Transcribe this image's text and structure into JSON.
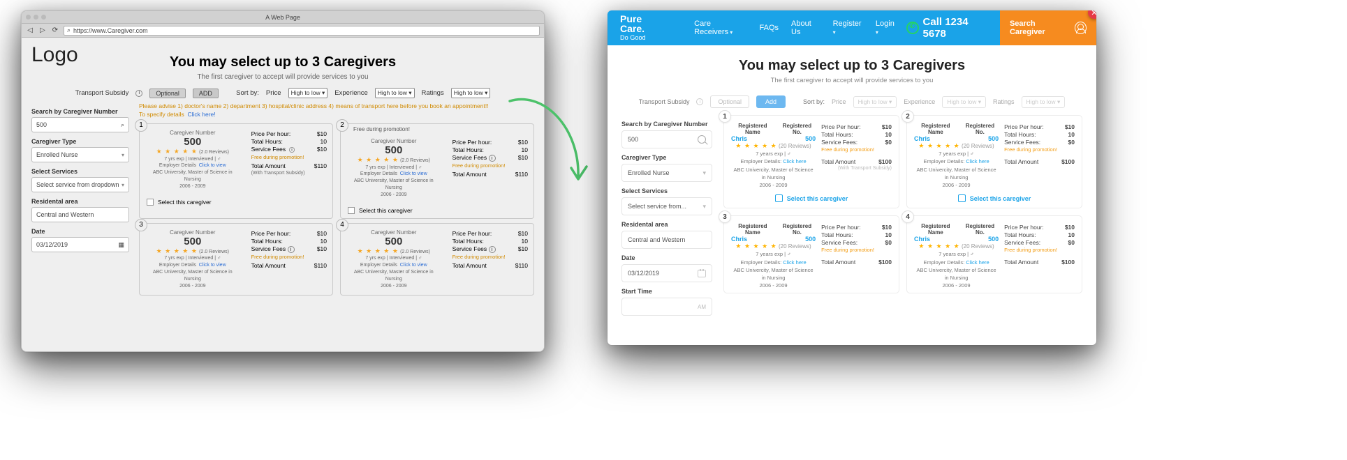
{
  "wire": {
    "window_title": "A Web Page",
    "url": "https://www.Caregiver.com",
    "logo": "Logo",
    "h1": "You may select up to 3 Caregivers",
    "sub": "The first caregiver to accept will provide services to you",
    "filter": {
      "subsidy_label": "Transport Subsidy",
      "optional": "Optional",
      "add": "ADD",
      "sort_label": "Sort by:",
      "price_label": "Price",
      "experience_label": "Experience",
      "ratings_label": "Ratings",
      "opt": "High to low"
    },
    "warn_line1": "Please advise 1) doctor's name 2) department 3) hospital/clinic address 4) means of transport here before you book an appointment!!",
    "warn_line2_a": "To specify details",
    "warn_line2_b": "Click here!",
    "sidebar": {
      "search_label": "Search by Caregiver Number",
      "search_value": "500",
      "type_label": "Caregiver Type",
      "type_value": "Enrolled Nurse",
      "services_label": "Select Services",
      "services_value": "Select service from dropdown",
      "area_label": "Residental area",
      "area_value": "Central and Western",
      "date_label": "Date",
      "date_value": "03/12/2019"
    },
    "card": {
      "top_label": "Caregiver Number",
      "number": "500",
      "stars": "★ ★ ★ ★ ★",
      "reviews": "(2.0 Reviews)",
      "exp_line": "7 yrs exp  |  Interviewed  |  ♂",
      "employer_prefix": "Employer Details",
      "click_to_view": "Click to view",
      "edu": "ABC University, Master of Science in Nursing",
      "years": "2006 - 2009",
      "price_lbl": "Price Per hour:",
      "price_val": "$10",
      "hours_lbl": "Total Hours:",
      "hours_val": "10",
      "fees_lbl": "Service Fees",
      "fees_val": "$10",
      "promo": "Free during promotion!",
      "total_lbl": "Total Amount",
      "total_val": "$110",
      "with_sub": "(With Transport Subsidy)",
      "free_promo_header": "Free during promotion!",
      "select": "Select this caregiver"
    },
    "nums": [
      "1",
      "2",
      "3",
      "4"
    ]
  },
  "final": {
    "brand": "Pure Care.",
    "tagline": "Do Good",
    "nav": {
      "receivers": "Care Receivers",
      "faqs": "FAQs",
      "about": "About Us",
      "register": "Register",
      "login": "Login"
    },
    "call_label": "Call 1234 5678",
    "search_btn": "Search Caregiver",
    "h1": "You may select up to 3 Caregivers",
    "sub": "The first caregiver to accept will provide services to you",
    "filter": {
      "subsidy_label": "Transport Subsidy",
      "optional": "Optional",
      "add": "Add",
      "sort_label": "Sort by:",
      "price_label": "Price",
      "experience_label": "Experience",
      "ratings_label": "Ratings",
      "opt": "High to low"
    },
    "sidebar": {
      "search_label": "Search by Caregiver Number",
      "search_value": "500",
      "type_label": "Caregiver Type",
      "type_value": "Enrolled Nurse",
      "services_label": "Select Services",
      "services_value": "Select service from...",
      "area_label": "Residental area",
      "area_value": "Central and Western",
      "date_label": "Date",
      "date_value": "03/12/2019",
      "start_label": "Start Time",
      "am": "AM"
    },
    "card": {
      "name_lbl": "Registered Name",
      "no_lbl": "Registered No.",
      "name": "Chris",
      "no": "500",
      "stars": "★ ★ ★ ★ ★",
      "reviews": "(20 Reviews)",
      "exp_line": "7 years exp  |  ♂",
      "employer_prefix": "Employer Details:",
      "click_here": "Click here",
      "edu": "ABC Univercity, Master of Science in Nursing",
      "years": "2006 - 2009",
      "price_lbl": "Price Per hour:",
      "price_val": "$10",
      "hours_lbl": "Total Hours:",
      "hours_val": "10",
      "fees_lbl": "Service Fees:",
      "fees_val": "$0",
      "promo": "Free during promotion!",
      "total_lbl": "Total Amount",
      "total_val": "$100",
      "with_sub": "(With Transport Subsidy)",
      "select": "Select this caregiver"
    },
    "nums": [
      "1",
      "2",
      "3",
      "4"
    ]
  }
}
